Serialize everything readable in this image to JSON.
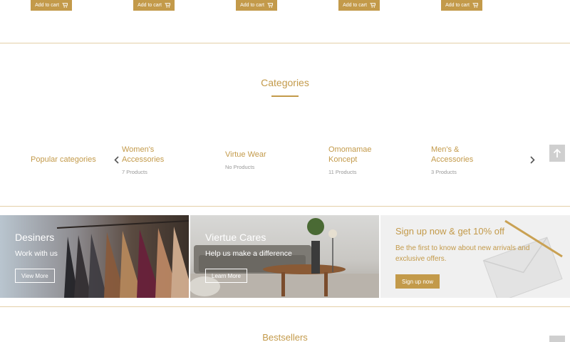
{
  "products_row": {
    "add_to_cart_label": "Add to cart"
  },
  "categories": {
    "title": "Categories",
    "popular_label": "Popular categories",
    "items": [
      {
        "name": "Women's Accessories",
        "count": "7 Products"
      },
      {
        "name": "Virtue Wear",
        "count": "No Products"
      },
      {
        "name": "Omomamae Koncept",
        "count": "11 Products"
      },
      {
        "name": "Men's & Accessories",
        "count": "3 Products"
      }
    ]
  },
  "banners": {
    "designers": {
      "title": "Desiners",
      "subtitle": "Work with us",
      "button": "View More"
    },
    "virtue_cares": {
      "title": "Viertue Cares",
      "subtitle": "Help us make a difference",
      "button": "Learn More"
    },
    "signup": {
      "title": "Sign up now & get 10% off",
      "text": "Be the first to know about new arrivals and exclusive offers.",
      "button": "Sign up now"
    }
  },
  "bestsellers": {
    "title": "Bestsellers"
  },
  "colors": {
    "accent": "#c39a4a",
    "divider": "#e4cfa8"
  },
  "icons": [
    "cart-icon",
    "chevron-left-icon",
    "chevron-right-icon",
    "arrow-up-icon"
  ]
}
